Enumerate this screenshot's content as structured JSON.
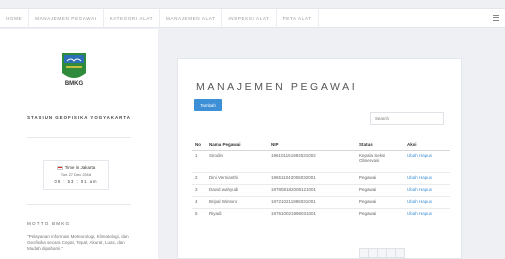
{
  "nav": {
    "items": [
      "HOME",
      "MANAJEMEN PEGAWAI",
      "KATEGORI ALAT",
      "MANAJEMEN ALAT",
      "INSPEKSI ALAT",
      "PETA ALAT"
    ]
  },
  "sidebar": {
    "logo_text": "BMKG",
    "station": "STASIUN GEOFISIKA YOGYAKARTA",
    "time": {
      "zone": "Time in Jakarta",
      "date": "Tue 27 Dec 2016",
      "clock": "09 : 53 : 01 am"
    },
    "motto_title": "MOTTO BMKG",
    "motto_text": "\"Pelayanan informasi Meteorologi, Klimatologi, dan Geofisika secara Cepat, Tepat, Akurat, Luas, dan Mudah dipahami.\""
  },
  "main": {
    "title": "MANAJEMEN PEGAWAI",
    "add_label": "Tambah",
    "search_placeholder": "Search",
    "table": {
      "headers": [
        "No",
        "Nama Pegawai",
        "NIP",
        "Status",
        "Aksi"
      ],
      "rows": [
        {
          "no": "1",
          "nama": "Sirodin",
          "nip": "196101151984031002",
          "status": "Kepala Seksi Observasi",
          "ubah": "Ubah",
          "hapus": "Hapus"
        },
        {
          "no": "2",
          "nama": "Dini Vernianthi",
          "nip": "196511042006032001",
          "status": "Pegawai",
          "ubah": "Ubah",
          "hapus": "Hapus"
        },
        {
          "no": "3",
          "nama": "David wahyudi",
          "nip": "197808182008121001",
          "status": "Pegawai",
          "ubah": "Ubah",
          "hapus": "Hapus"
        },
        {
          "no": "4",
          "nama": "Bripal Wintoro",
          "nip": "197210211996031001",
          "status": "Pegawai",
          "ubah": "Ubah",
          "hapus": "Hapus"
        },
        {
          "no": "5",
          "nama": "Riyadi",
          "nip": "197510021996031001",
          "status": "Pegawai",
          "ubah": "Ubah",
          "hapus": "Hapus"
        }
      ]
    }
  }
}
